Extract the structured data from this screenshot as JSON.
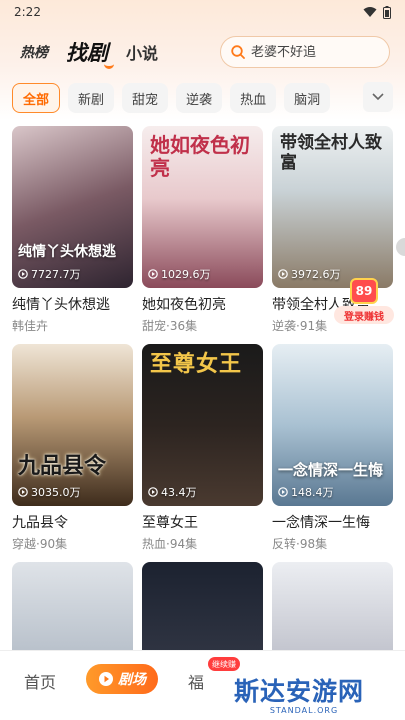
{
  "status_bar": {
    "time": "2:22"
  },
  "top_nav": {
    "tabs": [
      {
        "label": "热榜",
        "active": false
      },
      {
        "label": "找剧",
        "active": true
      },
      {
        "label": "小说",
        "active": false
      }
    ],
    "search_placeholder": "老婆不好追"
  },
  "chips": [
    {
      "label": "全部",
      "active": true
    },
    {
      "label": "新剧",
      "active": false
    },
    {
      "label": "甜宠",
      "active": false
    },
    {
      "label": "逆袭",
      "active": false
    },
    {
      "label": "热血",
      "active": false
    },
    {
      "label": "脑洞",
      "active": false
    }
  ],
  "cards": [
    {
      "title": "纯情丫头休想逃",
      "meta": "韩佳卉",
      "views": "7727.7万",
      "poster_text": "纯情丫头休想逃",
      "colors": [
        "#3a2e3a",
        "#b89aa0"
      ]
    },
    {
      "title": "她如夜色初亮",
      "meta": "甜宠·36集",
      "views": "1029.6万",
      "poster_text": "她如夜色初亮",
      "colors": [
        "#f1e4e4",
        "#b26b78"
      ]
    },
    {
      "title": "带领全村人致富",
      "meta": "逆袭·91集",
      "views": "3972.6万",
      "poster_text": "带领全村人致富",
      "colors": [
        "#dfe6e8",
        "#7a6b5a"
      ]
    },
    {
      "title": "九品县令",
      "meta": "穿越·90集",
      "views": "3035.0万",
      "poster_text": "九品县令",
      "colors": [
        "#e8dccb",
        "#5a4028"
      ]
    },
    {
      "title": "至尊女王",
      "meta": "热血·94集",
      "views": "43.4万",
      "poster_text": "至尊女王",
      "colors": [
        "#161616",
        "#3a2a22"
      ]
    },
    {
      "title": "一念情深一生悔",
      "meta": "反转·98集",
      "views": "148.4万",
      "poster_text": "一念情深一生悔",
      "colors": [
        "#cfe0ea",
        "#6a8aa6"
      ]
    },
    {
      "title": "",
      "meta": "",
      "views": "",
      "poster_text": "",
      "colors": [
        "#d8dde4",
        "#8a96a6"
      ]
    },
    {
      "title": "",
      "meta": "",
      "views": "",
      "poster_text": "",
      "colors": [
        "#1f2430",
        "#4a4a5a"
      ]
    },
    {
      "title": "",
      "meta": "",
      "views": "",
      "poster_text": "",
      "colors": [
        "#e8e8ee",
        "#8a8a9a"
      ]
    }
  ],
  "float_badge": {
    "amount": "89",
    "label": "登录赚钱"
  },
  "bottom_nav": {
    "home": "首页",
    "theater": "剧场",
    "welfare": "福",
    "welfare_badge": "继续赚"
  },
  "watermark": {
    "main": "斯达安游网",
    "sub": "STANDAL.ORG"
  }
}
